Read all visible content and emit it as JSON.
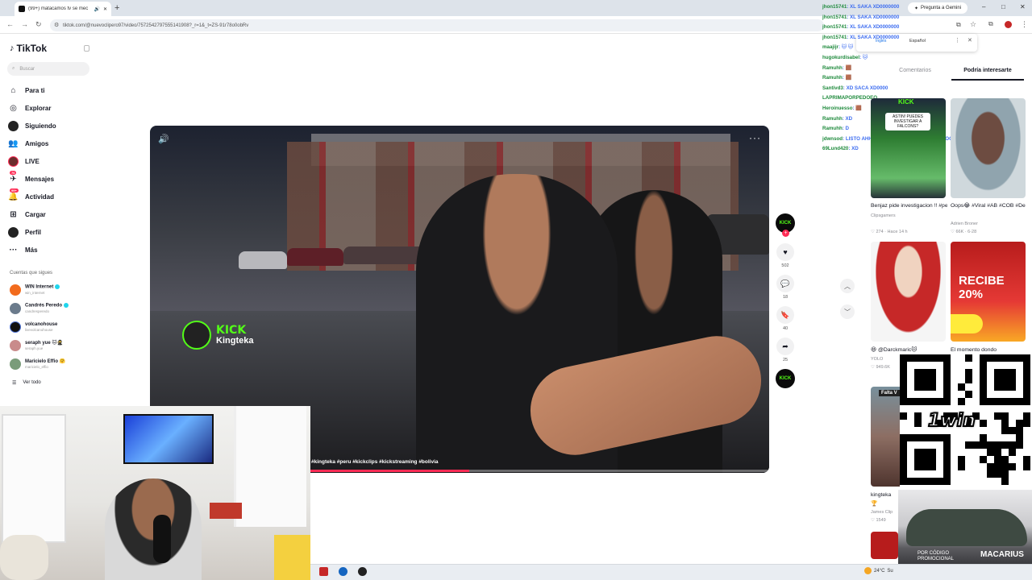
{
  "browser": {
    "tab_title": "(99+) matacamos tv se mec",
    "new_tab": "+",
    "url": "tiktok.com/@nuevoclipero97/video/7572542797555141908?_r=1&_t=ZS-91r78o0obRv",
    "gemini_button": "Pregunta a Gemini",
    "translate_popup": {
      "lang": "Español",
      "lang2": "Inglés"
    },
    "win_controls": [
      "–",
      "□",
      "✕"
    ]
  },
  "sidebar": {
    "logo": "TikTok",
    "search_placeholder": "Buscar",
    "nav": [
      {
        "label": "Para ti",
        "icon": "home-icon"
      },
      {
        "label": "Explorar",
        "icon": "compass-icon"
      },
      {
        "label": "Siguiendo",
        "icon": "following-icon"
      },
      {
        "label": "Amigos",
        "icon": "friends-icon"
      },
      {
        "label": "LIVE",
        "icon": "live-icon"
      },
      {
        "label": "Mensajes",
        "icon": "messages-icon",
        "badge": "76"
      },
      {
        "label": "Actividad",
        "icon": "activity-icon",
        "badge": "99+"
      },
      {
        "label": "Cargar",
        "icon": "upload-icon"
      },
      {
        "label": "Perfil",
        "icon": "profile-icon"
      },
      {
        "label": "Más",
        "icon": "more-icon"
      }
    ],
    "following_title": "Cuentas que sigues",
    "following": [
      {
        "name": "WIN Internet",
        "user": "win_internet",
        "verified": true,
        "color": "#f26b1d"
      },
      {
        "name": "Candrés Peredo",
        "user": "candresperedo",
        "verified": true,
        "color": "#6b7b8c"
      },
      {
        "name": "volcanohouse",
        "user": "livevolcanohouse",
        "verified": false,
        "color": "#111111"
      },
      {
        "name": "seraph yue 🐱🥷",
        "user": "seraph.yue",
        "verified": false,
        "color": "#c98b8b"
      },
      {
        "name": "Maricielo Effio 🤗",
        "user": "maricielo_effio",
        "verified": false,
        "color": "#7a9c7a"
      }
    ],
    "see_all": "Ver todo"
  },
  "video": {
    "watermark_brand": "KICK",
    "watermark_name": "Kingteka",
    "hashtags": "#kingteka #peru #kickclips #kickstreaming #bolivia",
    "progress": 0.516
  },
  "actions": {
    "avatar_label": "KICK",
    "likes": "502",
    "comments": "18",
    "saves": "40",
    "shares": "25"
  },
  "chat": [
    {
      "user": "jhon15741",
      "msg": ": XL SAKA XD0000000"
    },
    {
      "user": "jhon15741",
      "msg": ": XL SAKA XD0000000"
    },
    {
      "user": "jhon15741",
      "msg": ": XL SAKA XD0000000"
    },
    {
      "user": "jhon15741",
      "msg": ": XL SAKA XD0000000"
    },
    {
      "user": "maajijr",
      "msg": ": 🐱 🐱"
    },
    {
      "user": "hugokurdisabel",
      "msg": ": 🐱"
    },
    {
      "user": "Ramuhh",
      "msg": ": 🟫"
    },
    {
      "user": "Ramuhh",
      "msg": ": 🟫"
    },
    {
      "user": "Santivd3",
      "msg": ": XD SACA XD0000"
    },
    {
      "user": "LAPRIMAPORPEDOEO",
      "msg": ""
    },
    {
      "user": "Heroinuesso",
      "msg": ": 🟫"
    },
    {
      "user": "Ramuhh",
      "msg": ": XD"
    },
    {
      "user": "Ramuhh",
      "msg": ": D"
    },
    {
      "user": "jdwnsod",
      "msg": ": LISTO AHHHHHHHHHHHHHHHHHHHOOOOOOOOOFFFFFFFFFFFFF"
    },
    {
      "user": "69Lund420",
      "msg": ": XD"
    }
  ],
  "right_panel": {
    "tabs": [
      "Comentarios",
      "Podría interesarte"
    ],
    "active_tab": 1,
    "cards": [
      {
        "caption": "Benjaz pide investigacion !! #peru...",
        "author": "Clipsgamers",
        "likes": "274",
        "time": "Hace 14 h",
        "overlay": "ASTIN! PUEDES INVESTIGAR A FALCONS?"
      },
      {
        "caption": "Oops😂 #Viral #AB #COB #DeenTheGreat...",
        "author": "Adrien Broner",
        "likes": "66K",
        "time": "6-28",
        "overlay": ""
      },
      {
        "caption": "😆 @Darckmaric🐱",
        "author": "YOLO",
        "likes": "949.6K",
        "time": "",
        "overlay": ""
      },
      {
        "caption": "El momento dondo",
        "author": "",
        "likes": "",
        "time": "",
        "overlay": "RECIBE 20%"
      },
      {
        "caption": "kingteka 🏆 reencuent",
        "author": "James Clip",
        "likes": "1549",
        "time": "",
        "overlay": "Falta V"
      }
    ]
  },
  "promo": {
    "brand": "1win",
    "code_label": "POR CÓDIGO PROMOCIONAL",
    "code": "MACARIUS"
  },
  "taskbar": {
    "weather": "24°C",
    "weather_extra": "Su"
  }
}
